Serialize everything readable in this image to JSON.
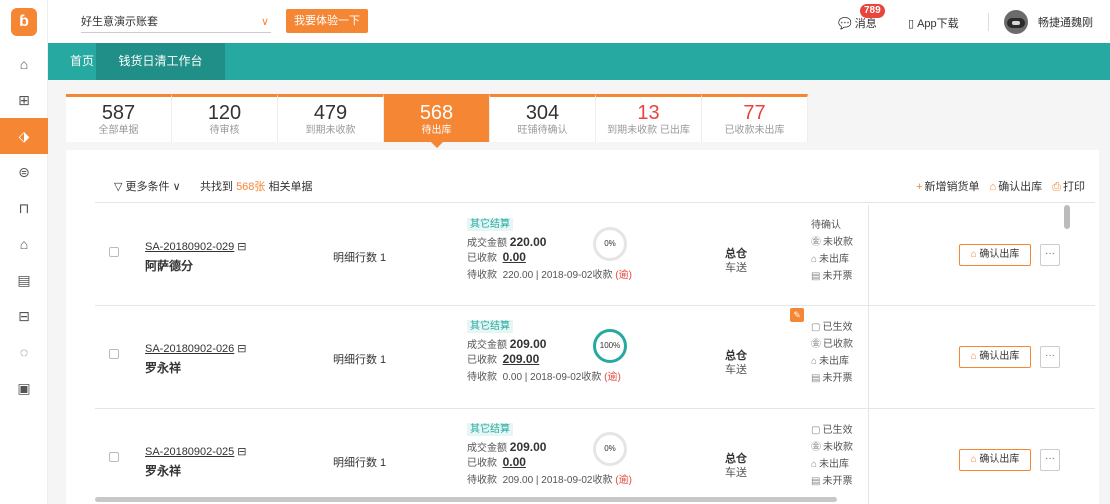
{
  "topbar": {
    "account": "好生意演示账套",
    "try_button": "我要体验一下",
    "messages_label": "消息",
    "messages_badge": "789",
    "app_download": "App下载",
    "username": "畅捷通魏刚"
  },
  "nav": {
    "home": "首页",
    "tab": "钱货日清工作台"
  },
  "sidebar_icons": [
    "home-icon",
    "gift-icon",
    "warehouse-icon",
    "bag-icon",
    "briefcase-icon",
    "building-icon",
    "clipboard-icon",
    "scan-icon",
    "loading-icon",
    "new-icon"
  ],
  "stats": [
    {
      "num": "587",
      "label": "全部单据"
    },
    {
      "num": "120",
      "label": "待审核"
    },
    {
      "num": "479",
      "label": "到期未收款"
    },
    {
      "num": "568",
      "label": "待出库"
    },
    {
      "num": "304",
      "label": "旺铺待确认"
    },
    {
      "num": "13",
      "label": "到期未收款 已出库"
    },
    {
      "num": "77",
      "label": "已收款未出库"
    }
  ],
  "toolbar": {
    "filter": "更多条件",
    "found_prefix": "共找到 ",
    "found_count": "568张",
    "found_suffix": " 相关单据",
    "new_order": "新增销货单",
    "confirm_out": "确认出库",
    "print": "打印"
  },
  "rows": [
    {
      "order_no": "SA-20180902-029",
      "customer": "阿萨德分",
      "lines": "明细行数 1",
      "settle_tag": "其它结算",
      "amount_label": "成交金额",
      "amount": "220.00",
      "paid_label": "已收款",
      "paid": "0.00",
      "due_label": "待收款",
      "due": "220.00 | 2018-09-02收款",
      "overdue": "(逾)",
      "progress": "0%",
      "warehouse": "总仓",
      "delivery": "车送",
      "status": [
        "待确认",
        "未收款",
        "未出库",
        "未开票"
      ],
      "confirm": "确认出库",
      "more": "···"
    },
    {
      "order_no": "SA-20180902-026",
      "customer": "罗永祥",
      "lines": "明细行数 1",
      "settle_tag": "其它结算",
      "amount_label": "成交金额",
      "amount": "209.00",
      "paid_label": "已收款",
      "paid": "209.00",
      "due_label": "待收款",
      "due": "0.00 | 2018-09-02收款",
      "overdue": "(逾)",
      "progress": "100%",
      "warehouse": "总仓",
      "delivery": "车送",
      "status": [
        "已生效",
        "已收款",
        "未出库",
        "未开票"
      ],
      "confirm": "确认出库",
      "more": "···"
    },
    {
      "order_no": "SA-20180902-025",
      "customer": "罗永祥",
      "lines": "明细行数 1",
      "settle_tag": "其它结算",
      "amount_label": "成交金额",
      "amount": "209.00",
      "paid_label": "已收款",
      "paid": "0.00",
      "due_label": "待收款",
      "due": "209.00 | 2018-09-02收款",
      "overdue": "(逾)",
      "progress": "0%",
      "warehouse": "总仓",
      "delivery": "车送",
      "status": [
        "已生效",
        "未收款",
        "未出库",
        "未开票"
      ],
      "confirm": "确认出库",
      "more": "···"
    }
  ],
  "colors": {
    "accent": "#f58634",
    "teal": "#26a9a0",
    "overdue": "#e8453c"
  }
}
